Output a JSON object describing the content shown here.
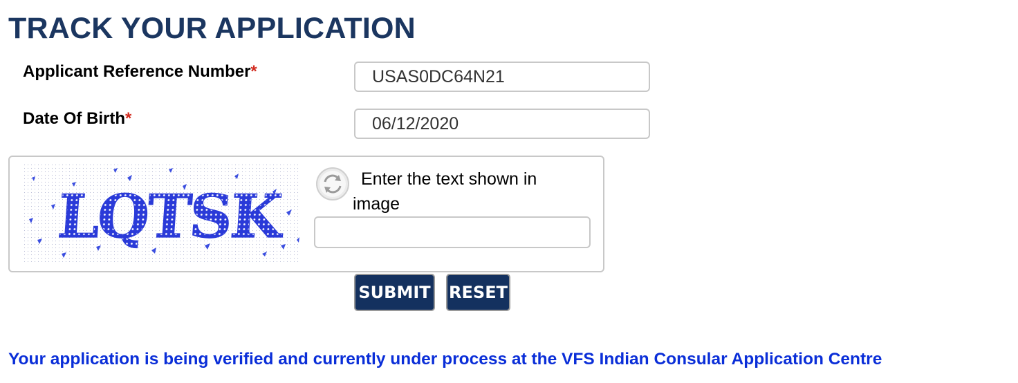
{
  "page": {
    "title": "TRACK YOUR APPLICATION"
  },
  "form": {
    "reference": {
      "label": "Applicant Reference Number",
      "required_mark": "*",
      "value": "USAS0DC64N21"
    },
    "dob": {
      "label": "Date Of Birth",
      "required_mark": "*",
      "value": "06/12/2020"
    }
  },
  "captcha": {
    "image_text": "LQTSK",
    "prompt": "Enter the text shown in image",
    "input_value": "",
    "refresh_icon": "refresh-icon",
    "text_color": "#2a3ad8"
  },
  "buttons": {
    "submit": "SUBMIT",
    "reset": "RESET"
  },
  "status": {
    "message": "Your application is being verified and currently under process at the VFS Indian Consular Application Centre"
  },
  "colors": {
    "title": "#1b3660",
    "button_bg": "#14315f",
    "required": "#d22b1f",
    "status_text": "#0a2ed8"
  }
}
